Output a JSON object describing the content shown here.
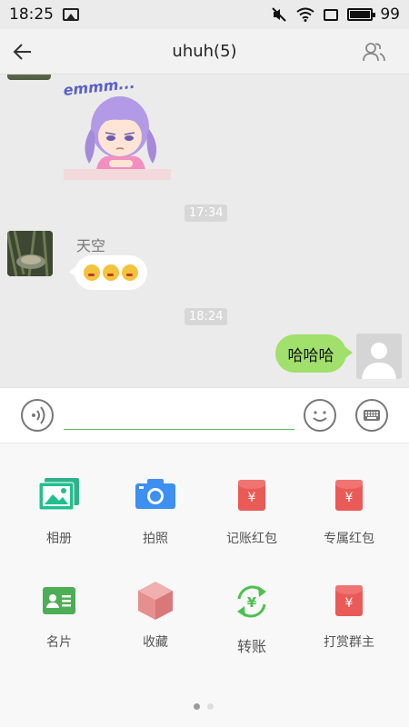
{
  "status": {
    "time": "18:25",
    "battery": "99"
  },
  "header": {
    "title": "uhuh(5)"
  },
  "chat": {
    "sticker_text": "emmm...",
    "timestamps": [
      "17:34",
      "18:24"
    ],
    "sender_name": "天空",
    "my_message": "哈哈哈"
  },
  "input": {
    "placeholder": ""
  },
  "panel": {
    "items": [
      {
        "label": "相册",
        "icon": "album-icon"
      },
      {
        "label": "拍照",
        "icon": "camera-icon"
      },
      {
        "label": "记账红包",
        "icon": "red-packet-icon"
      },
      {
        "label": "专属红包",
        "icon": "red-packet-icon"
      },
      {
        "label": "名片",
        "icon": "contact-card-icon"
      },
      {
        "label": "收藏",
        "icon": "favorites-box-icon"
      },
      {
        "label": "转账",
        "icon": "transfer-icon"
      },
      {
        "label": "打赏群主",
        "icon": "red-packet-icon"
      }
    ],
    "page_count": 2,
    "current_page": 1
  },
  "colors": {
    "accent_green": "#5cb85c",
    "bubble_green": "#a0e06b",
    "red_packet": "#ea5a56"
  }
}
